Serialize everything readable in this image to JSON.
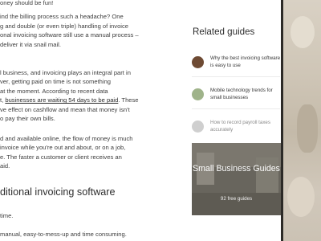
{
  "article": {
    "paragraphs": [
      {
        "lines": [
          {
            "text": "oney should be fun!"
          },
          {
            "text": "ind the billing process such a headache? One"
          },
          {
            "text": "g and double (or even triple) handling of invoice"
          },
          {
            "text": "onal invoicing software still use a manual process –"
          },
          {
            "text": "deliver it via snail mail."
          }
        ]
      },
      {
        "lines": [
          {
            "text": "l business, and invoicing plays an integral part in"
          },
          {
            "text": "ver, getting paid on time is not something"
          },
          {
            "text": "at the moment. According to recent data"
          },
          {
            "pre": "t, ",
            "link": "businesses are waiting 54 days to be paid",
            "post": ". These"
          },
          {
            "text": "ve effect on cashflow and mean that money isn't"
          },
          {
            "text": "o pay their own bills."
          }
        ]
      },
      {
        "lines": [
          {
            "text": "d and available online, the flow of money is much"
          },
          {
            "text": "invoice while you're out and about, or on a job,"
          },
          {
            "text": "e. The faster a customer or client receives an"
          },
          {
            "text": "aid."
          }
        ]
      }
    ],
    "heading": "ditional invoicing software",
    "after_heading": [
      {
        "text": "time."
      },
      {
        "text": "manual, easy-to-mess-up and time consuming."
      }
    ]
  },
  "sidebar": {
    "title": "Related guides",
    "guides": [
      {
        "label": "Why the best invoicing software is easy to use",
        "thumb_icon": "invoice-photo-thumb",
        "thumb_color": "#6e4a33"
      },
      {
        "label": "Mobile technology trends for small businesses",
        "thumb_icon": "mobile-photo-thumb",
        "thumb_color": "#9fb38a"
      },
      {
        "label": "How to record payroll taxes accurately",
        "thumb_icon": "payroll-photo-thumb",
        "thumb_color": "#cfcfcf"
      }
    ],
    "promo": {
      "title": "Small Business Guides",
      "count": "92 free guides"
    }
  },
  "colors": {
    "text": "#3e3e3e",
    "heading": "#2d2d2d",
    "promo_overlay": "#46443e"
  }
}
